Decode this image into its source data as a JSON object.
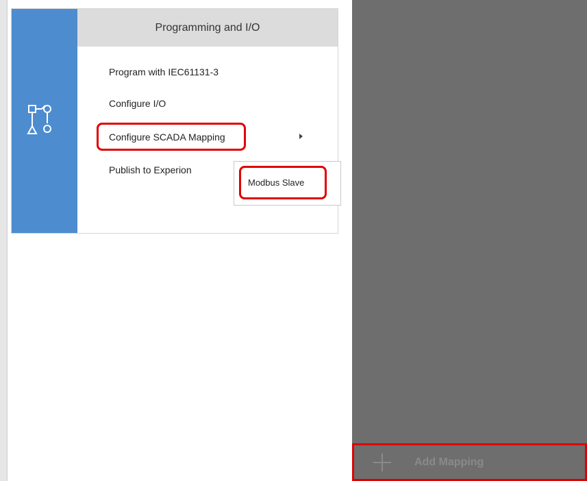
{
  "menu": {
    "header": "Programming and I/O",
    "items": [
      {
        "label": "Program with IEC61131-3"
      },
      {
        "label": "Configure I/O"
      },
      {
        "label": "Configure SCADA Mapping"
      },
      {
        "label": "Publish to Experion"
      }
    ],
    "submenu": {
      "items": [
        {
          "label": "Modbus Slave"
        }
      ]
    },
    "icon": "flow-diagram-icon"
  },
  "right_panel": {
    "add_button_label": "Add Mapping",
    "add_icon": "plus-icon"
  },
  "colors": {
    "side_blue": "#4d8ccf",
    "header_gray": "#dcdcdc",
    "panel_gray": "#6e6e6e",
    "highlight_red": "#e00000"
  }
}
